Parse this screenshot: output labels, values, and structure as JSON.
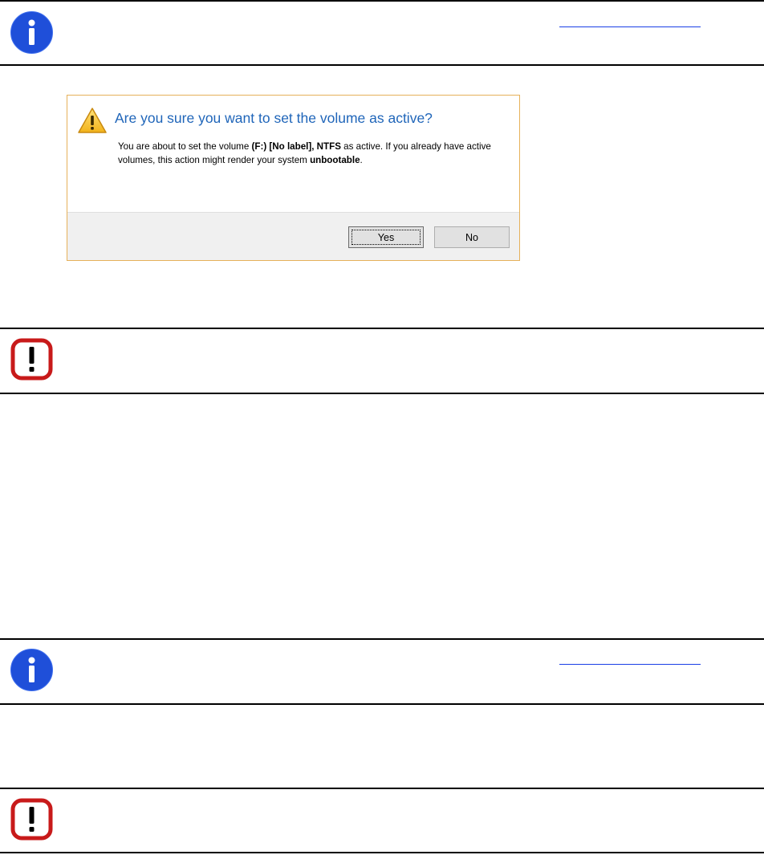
{
  "dialog": {
    "title": "Are you sure you want to set the volume as active?",
    "body_text_1": "You are about to set the volume ",
    "body_bold_1": "(F:) [No label], NTFS",
    "body_text_2": " as active. If you already have active volumes, this action might render your system ",
    "body_bold_2": "unbootable",
    "body_text_3": ".",
    "yes_label": "Yes",
    "no_label": "No"
  },
  "notes": [
    {
      "type": "info",
      "icon": "info-icon"
    },
    {
      "type": "warning",
      "icon": "exclamation-icon"
    },
    {
      "type": "info",
      "icon": "info-icon"
    },
    {
      "type": "warning",
      "icon": "exclamation-icon"
    }
  ],
  "colors": {
    "info_blue": "#1f4fd9",
    "warning_red": "#c81a1a",
    "link_blue": "#1a3fe6",
    "dialog_title": "#1f65b9",
    "dialog_border": "#e6b15a"
  }
}
